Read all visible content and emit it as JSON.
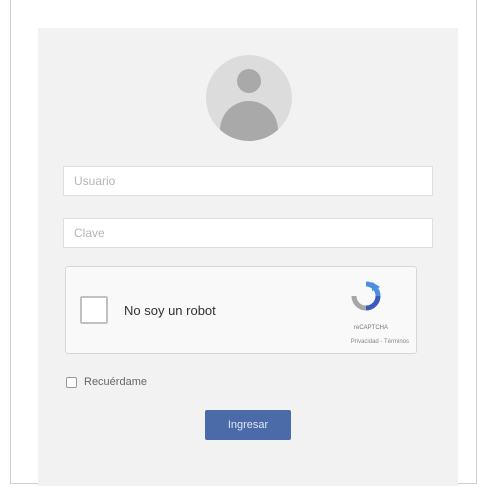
{
  "form": {
    "username_placeholder": "Usuario",
    "password_placeholder": "Clave",
    "remember_label": "Recuérdame",
    "submit_label": "Ingresar"
  },
  "captcha": {
    "label": "No soy un robot",
    "brand": "reCAPTCHA",
    "links": "Privacidad - Términos",
    "logo_icon": "recaptcha-icon"
  },
  "colors": {
    "card_bg": "#f2f2f2",
    "button_bg": "#4a6aa8",
    "captcha_blue": "#4a90e2"
  }
}
